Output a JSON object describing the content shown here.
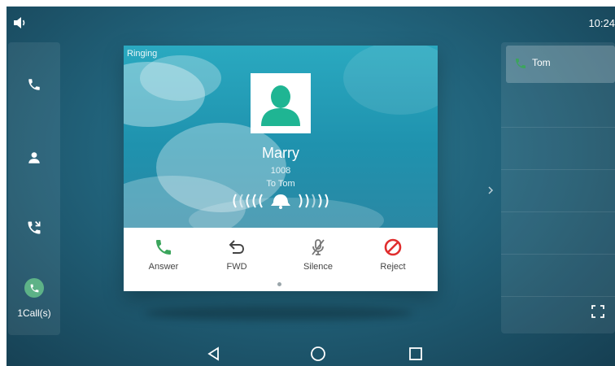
{
  "status_bar": {
    "time": "10:24",
    "volume_icon": "volume-icon"
  },
  "left_nav": {
    "items": [
      {
        "icon": "phone-icon"
      },
      {
        "icon": "contact-icon"
      },
      {
        "icon": "call-history-icon"
      }
    ],
    "active_call_icon": "phone-icon",
    "calls_label": "1Call(s)"
  },
  "call_card": {
    "state_label": "Ringing",
    "caller_name": "Marry",
    "caller_number": "1008",
    "to_label": "To Tom",
    "ringing_icon": "bell-icon",
    "actions": [
      {
        "label": "Answer",
        "icon": "phone-icon",
        "color": "#3ba55c"
      },
      {
        "label": "FWD",
        "icon": "forward-icon",
        "color": "#444444"
      },
      {
        "label": "Silence",
        "icon": "mute-microphone-icon",
        "color": "#888888"
      },
      {
        "label": "Reject",
        "icon": "reject-icon",
        "color": "#e02d2d"
      }
    ]
  },
  "right_panel": {
    "active_call": {
      "name": "Tom",
      "icon": "phone-icon"
    },
    "expand_icon": "expand-icon"
  },
  "nav_bar": {
    "keys": [
      "back-icon",
      "home-icon",
      "recent-apps-icon"
    ]
  },
  "colors": {
    "accent_green": "#5db287",
    "avatar_green": "#1fb593",
    "reject_red": "#e02d2d"
  }
}
